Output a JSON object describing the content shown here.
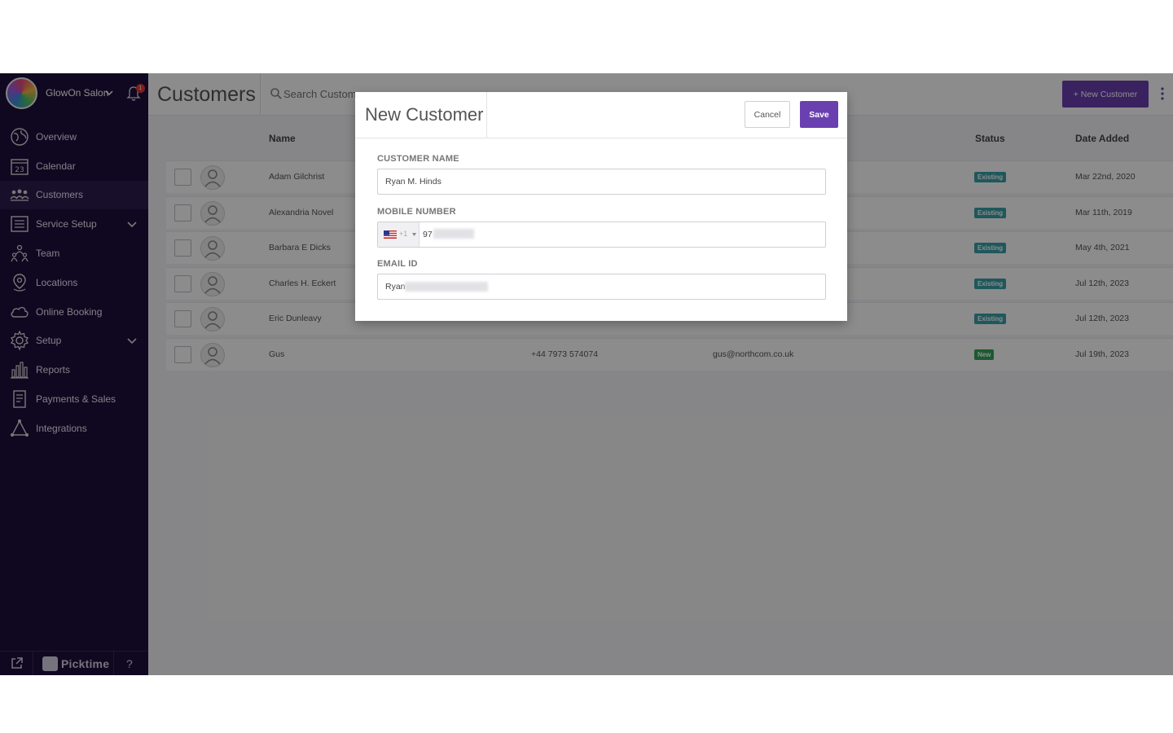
{
  "sidebar": {
    "salon_name": "GlowOn Salon",
    "notification_count": "1",
    "items": [
      {
        "label": "Overview",
        "icon": "globe-icon"
      },
      {
        "label": "Calendar",
        "icon": "calendar-icon"
      },
      {
        "label": "Customers",
        "icon": "customers-icon",
        "active": true
      },
      {
        "label": "Service Setup",
        "icon": "list-icon",
        "expandable": true
      },
      {
        "label": "Team",
        "icon": "team-icon"
      },
      {
        "label": "Locations",
        "icon": "location-pin-icon"
      },
      {
        "label": "Online Booking",
        "icon": "cloud-icon"
      },
      {
        "label": "Setup",
        "icon": "gear-icon",
        "expandable": true
      },
      {
        "label": "Reports",
        "icon": "bar-chart-icon"
      },
      {
        "label": "Payments & Sales",
        "icon": "receipt-icon"
      },
      {
        "label": "Integrations",
        "icon": "integrations-icon"
      }
    ],
    "calendar_day": "23",
    "footer": {
      "brand": "Picktime",
      "help": "?"
    }
  },
  "header": {
    "title": "Customers",
    "search_placeholder": "Search Customers",
    "new_customer_label": "+ New Customer"
  },
  "table": {
    "headers": {
      "name": "Name",
      "status": "Status",
      "date_added": "Date Added"
    },
    "rows": [
      {
        "name": "Adam Gilchrist",
        "phone": "",
        "email": "",
        "status": "Existing",
        "date": "Mar 22nd, 2020"
      },
      {
        "name": "Alexandria Novel",
        "phone": "",
        "email": "",
        "status": "Existing",
        "date": "Mar 11th, 2019"
      },
      {
        "name": "Barbara E Dicks",
        "phone": "",
        "email": "",
        "status": "Existing",
        "date": "May 4th, 2021"
      },
      {
        "name": "Charles H. Eckert",
        "phone": "",
        "email": "",
        "status": "Existing",
        "date": "Jul 12th, 2023"
      },
      {
        "name": "Eric Dunleavy",
        "phone": "",
        "email": "",
        "status": "Existing",
        "date": "Jul 12th, 2023"
      },
      {
        "name": "Gus",
        "phone": "+44 7973 574074",
        "email": "gus@northcom.co.uk",
        "status": "New",
        "date": "Jul 19th, 2023"
      }
    ]
  },
  "modal": {
    "title": "New Customer",
    "cancel_label": "Cancel",
    "save_label": "Save",
    "name_label": "CUSTOMER NAME",
    "name_value": "Ryan M. Hinds",
    "mobile_label": "MOBILE NUMBER",
    "dial_code": "+1",
    "mobile_value": "97",
    "email_label": "EMAIL ID",
    "email_value": "Ryan"
  },
  "colors": {
    "sidebar_bg": "#1e0f3c",
    "primary": "#6a3fb0",
    "existing_badge": "#3aa0a8",
    "new_badge": "#33a55a"
  }
}
